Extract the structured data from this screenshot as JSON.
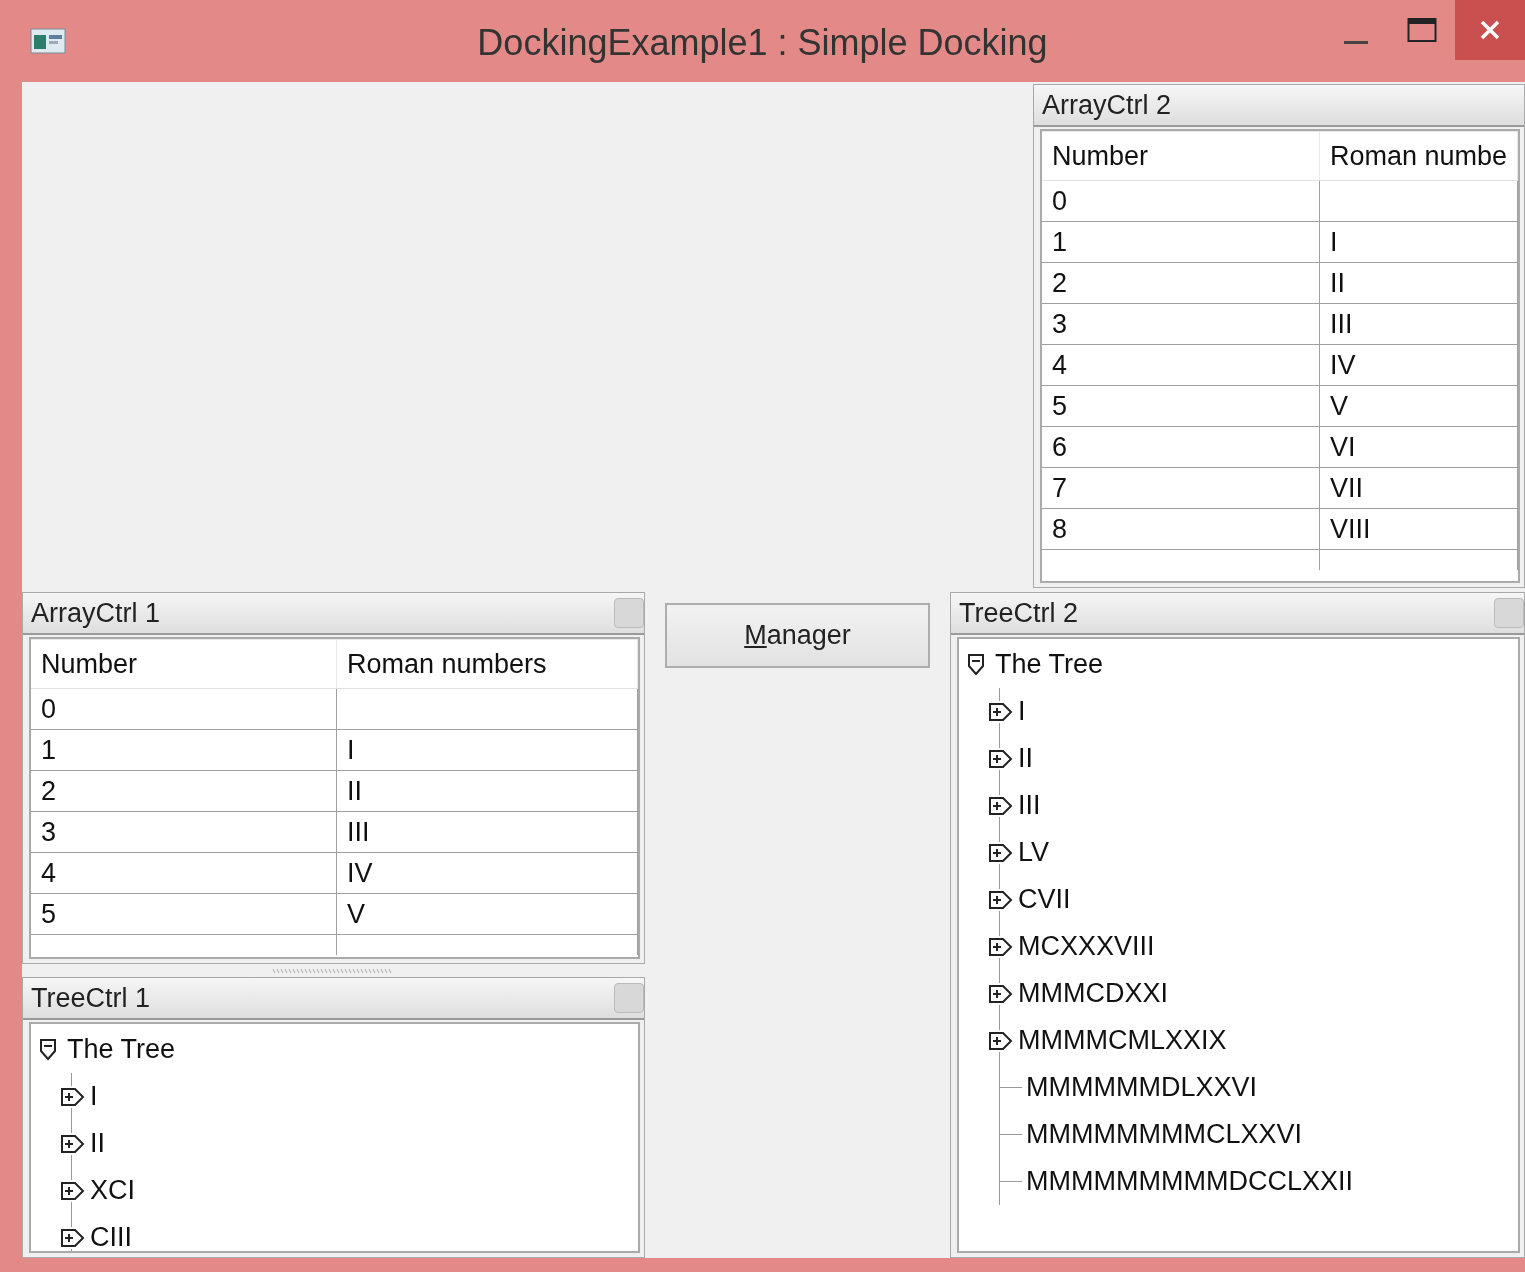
{
  "window": {
    "title": "DockingExample1 : Simple Docking"
  },
  "array_ctrl_2": {
    "title": "ArrayCtrl 2",
    "columns": [
      "Number",
      "Roman numbe"
    ],
    "rows": [
      [
        "0",
        ""
      ],
      [
        "1",
        "I"
      ],
      [
        "2",
        "II"
      ],
      [
        "3",
        "III"
      ],
      [
        "4",
        "IV"
      ],
      [
        "5",
        "V"
      ],
      [
        "6",
        "VI"
      ],
      [
        "7",
        "VII"
      ],
      [
        "8",
        "VIII"
      ]
    ]
  },
  "array_ctrl_1": {
    "title": "ArrayCtrl 1",
    "columns": [
      "Number",
      "Roman numbers"
    ],
    "rows": [
      [
        "0",
        ""
      ],
      [
        "1",
        "I"
      ],
      [
        "2",
        "II"
      ],
      [
        "3",
        "III"
      ],
      [
        "4",
        "IV"
      ],
      [
        "5",
        "V"
      ]
    ]
  },
  "tree_ctrl_1": {
    "title": "TreeCtrl 1",
    "root": {
      "label": "The Tree",
      "expanded": true,
      "children": [
        {
          "label": "I",
          "kind": "node",
          "expanded": false
        },
        {
          "label": "II",
          "kind": "node",
          "expanded": false
        },
        {
          "label": "XCI",
          "kind": "node",
          "expanded": false
        },
        {
          "label": "CIII",
          "kind": "node",
          "expanded": false
        }
      ]
    }
  },
  "manager_button": {
    "label": "Manager"
  },
  "tree_ctrl_2": {
    "title": "TreeCtrl 2",
    "root": {
      "label": "The Tree",
      "expanded": true,
      "children": [
        {
          "label": "I",
          "kind": "node",
          "expanded": false
        },
        {
          "label": "II",
          "kind": "node",
          "expanded": false
        },
        {
          "label": "III",
          "kind": "node",
          "expanded": false
        },
        {
          "label": "LV",
          "kind": "node",
          "expanded": false
        },
        {
          "label": "CVII",
          "kind": "node",
          "expanded": false
        },
        {
          "label": "MCXXXVIII",
          "kind": "node",
          "expanded": false
        },
        {
          "label": "MMMCDXXI",
          "kind": "node",
          "expanded": false
        },
        {
          "label": "MMMMCMLXXIX",
          "kind": "node",
          "expanded": false
        },
        {
          "label": "MMMMMMDLXXVI",
          "kind": "leaf"
        },
        {
          "label": "MMMMMMMMCLXXVI",
          "kind": "leaf"
        },
        {
          "label": "MMMMMMMMMDCCLXXII",
          "kind": "leaf"
        }
      ]
    }
  }
}
